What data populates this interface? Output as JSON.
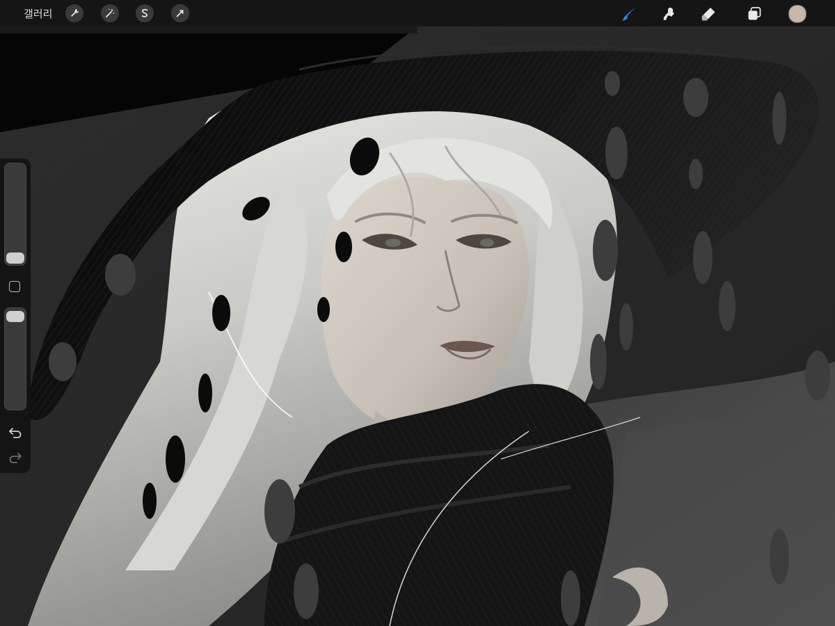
{
  "toolbar": {
    "gallery_label": "갤러리",
    "left_tools": [
      "wrench-icon",
      "magic-wand-icon",
      "selection-s-icon",
      "transform-arrow-icon"
    ],
    "right_tools": [
      "brush-icon",
      "smudge-icon",
      "eraser-icon",
      "layers-icon"
    ],
    "active_tool": "brush-icon",
    "active_tool_color": "#2f7df6",
    "current_color": "#c9b6a6"
  },
  "sidebar": {
    "brush_size_level": 0.1,
    "opacity_level": 0.95,
    "controls": [
      "brush-size-slider",
      "modify-button",
      "opacity-slider",
      "undo-icon",
      "redo-icon"
    ]
  },
  "canvas": {
    "description_colors": {
      "background": "#2a2a2a",
      "hair": "#d9d9d6",
      "skin": "#cfc8bf",
      "hat": "#0f0f0f",
      "scarf": "#141414"
    }
  }
}
